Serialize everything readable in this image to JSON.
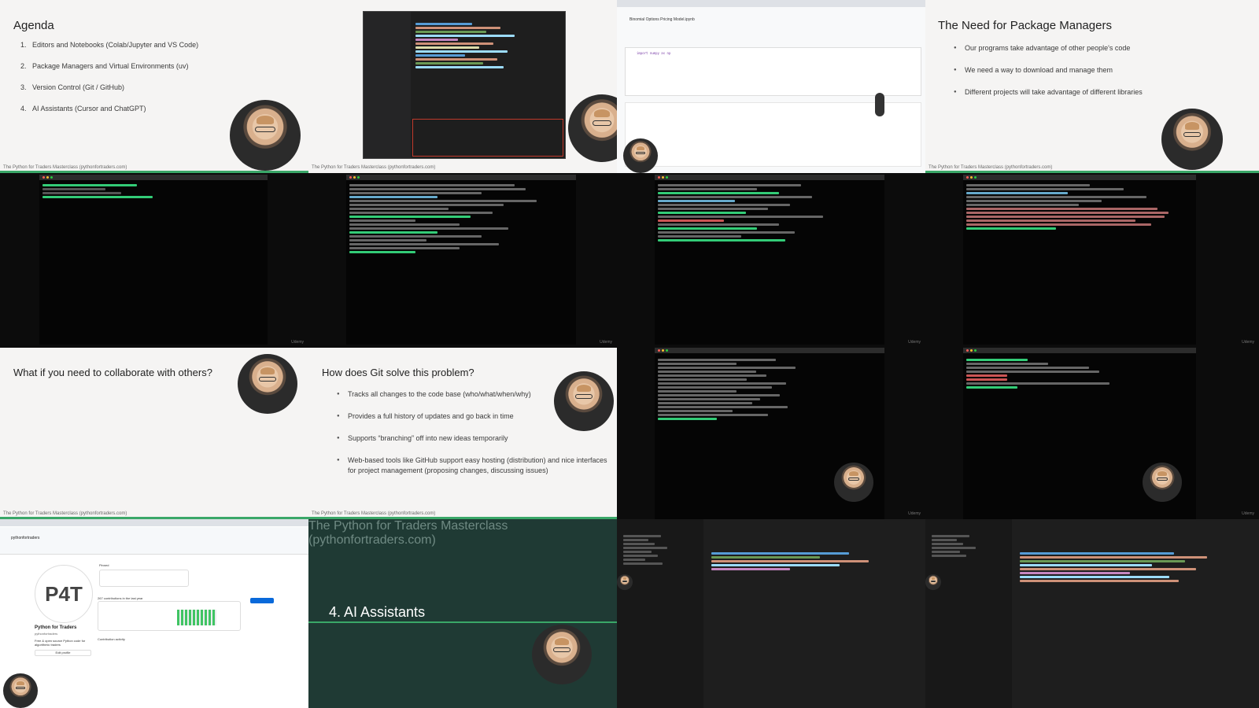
{
  "footer_text": "The Python for Traders Masterclass (pythonfortraders.com)",
  "watermark": "Udemy",
  "agenda": {
    "title": "Agenda",
    "items": [
      "Editors and Notebooks (Colab/Jupyter and VS Code)",
      "Package Managers and Virtual Environments (uv)",
      "Version Control (Git / GitHub)",
      "AI Assistants (Cursor and ChatGPT)"
    ]
  },
  "package_managers": {
    "title": "The Need for Package Managers",
    "bullets": [
      "Our programs take advantage of other people's code",
      "We need a way to download and manage them",
      "Different projects will take advantage of different libraries"
    ]
  },
  "collaborate": {
    "title": "What if you need to collaborate with others?"
  },
  "git_solve": {
    "title": "How does Git solve this problem?",
    "bullets": [
      "Tracks all changes to the code base (who/what/when/why)",
      "Provides a full history of updates and go back in time",
      "Supports “branching” off into new ideas temporarily",
      "Web-based tools like GitHub support easy hosting (distribution) and nice interfaces for project management (proposing changes, discussing issues)"
    ]
  },
  "ai_section": {
    "title": "4. AI Assistants"
  },
  "colab": {
    "notebook_title": "Binomial Options Pricing Model.ipynb",
    "code_hint": "import numpy as np"
  },
  "github": {
    "profile_name": "Python for Traders",
    "handle": "pythonfortraders",
    "logo_text": "P4T",
    "bio": "Free & open source Python code for algorithmic traders",
    "contributions": "267 contributions in the last year",
    "pinned_label": "Pinned",
    "activity_label": "Contribution activity",
    "edit_profile": "Edit profile"
  },
  "colors": {
    "accent_green": "#3aa768",
    "slide_bg": "#f5f4f3",
    "terminal_bg": "#0c0c0c",
    "editor_bg": "#1e1e1e"
  }
}
